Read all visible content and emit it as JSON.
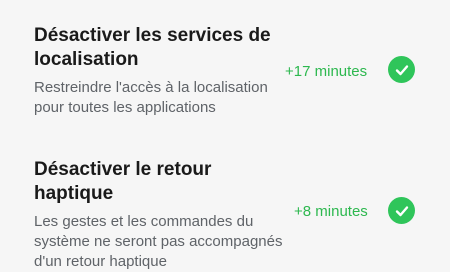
{
  "items": [
    {
      "title": "Désactiver les services de localisation",
      "description": "Restreindre l'accès à la localisation pour toutes les applications",
      "gain": "+17 minutes",
      "status_icon": "check-circle-icon",
      "accent": "#2fc55a"
    },
    {
      "title": "Désactiver le retour haptique",
      "description": "Les gestes et les commandes du système ne seront pas accompagnés d'un retour haptique",
      "gain": "+8 minutes",
      "status_icon": "check-circle-icon",
      "accent": "#2fc55a"
    }
  ]
}
